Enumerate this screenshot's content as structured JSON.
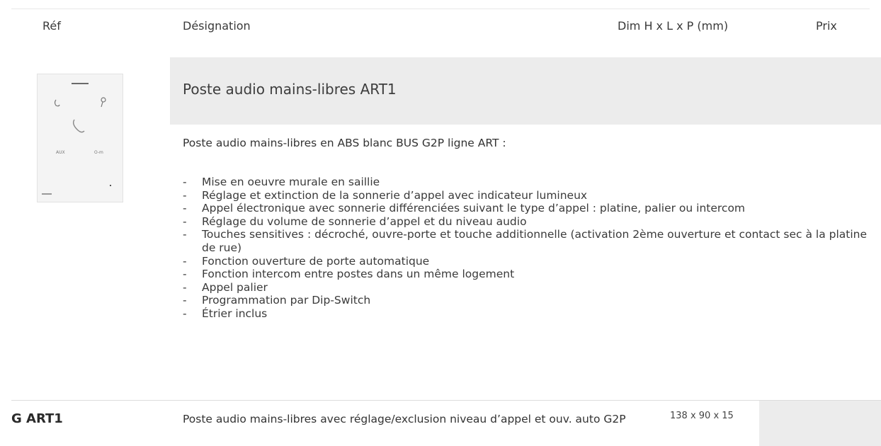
{
  "header": {
    "ref": "Réf",
    "designation": "Désignation",
    "dimensions": "Dim H x L x P (mm)",
    "price": "Prix"
  },
  "product": {
    "image_labels": [
      "AUX",
      "O-m"
    ],
    "title": "Poste audio mains-libres ART1",
    "intro": "Poste audio mains-libres en ABS blanc BUS G2P ligne ART :",
    "bullets": [
      "Mise en oeuvre murale en saillie",
      "Réglage et extinction de la sonnerie d’appel avec indicateur lumineux",
      "Appel électronique avec sonnerie différenciées suivant le type d’appel : platine, palier ou intercom",
      "Réglage du volume de sonnerie d’appel et du niveau audio",
      "Touches sensitives : décroché,  ouvre-porte et touche additionnelle (activation 2ème ouverture et contact sec à la platine de rue)",
      "Fonction ouverture de porte automatique",
      "Fonction intercom entre postes dans un même logement",
      "Appel palier",
      "Programmation par Dip-Switch",
      "Étrier inclus"
    ],
    "bullet_marker": "-"
  },
  "row": {
    "ref": "G ART1",
    "designation": "Poste audio mains-libres avec réglage/exclusion niveau d’appel et ouv. auto G2P",
    "dimensions": "138 x 90 x 15",
    "price": ""
  }
}
